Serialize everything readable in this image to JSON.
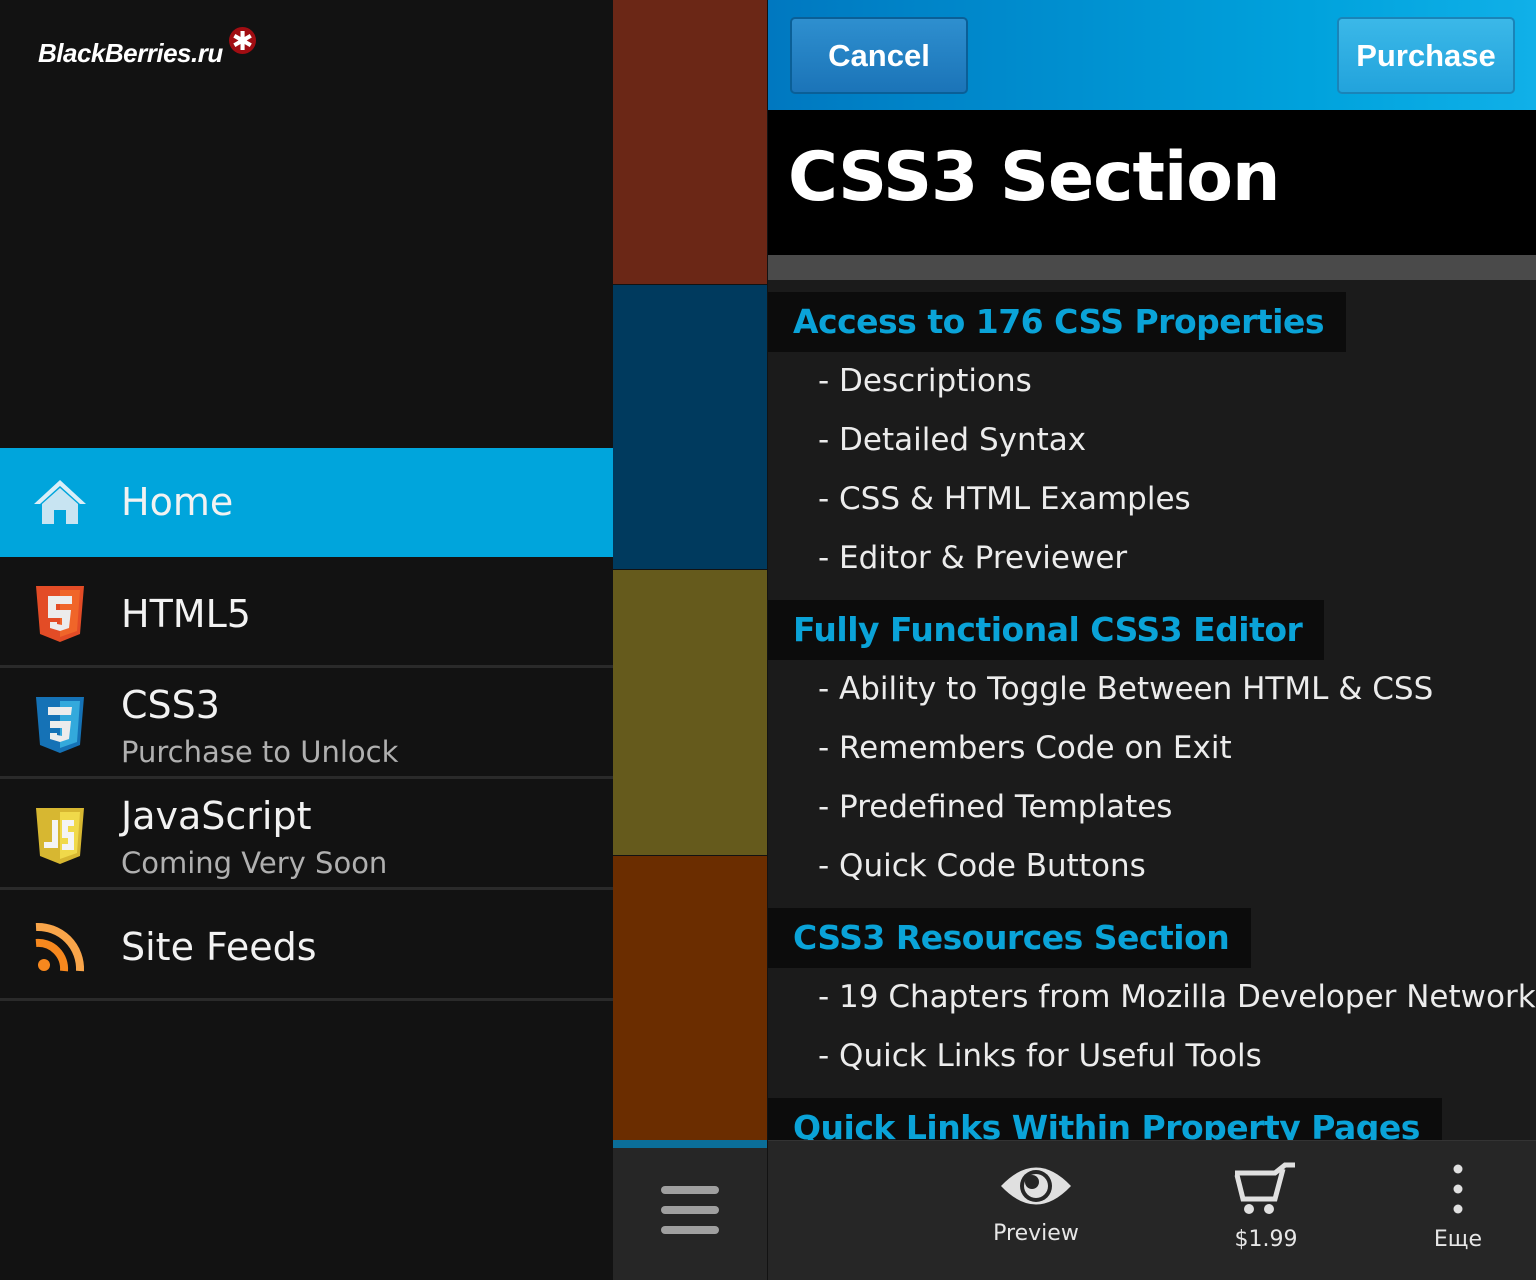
{
  "logo": {
    "text": "BlackBerries.ru",
    "star": "*"
  },
  "sidebar": {
    "items": [
      {
        "label": "Home",
        "icon": "home-icon",
        "active": true
      },
      {
        "label": "HTML5",
        "icon": "html5-icon"
      },
      {
        "label": "CSS3",
        "sub": "Purchase to Unlock",
        "icon": "css3-icon"
      },
      {
        "label": "JavaScript",
        "sub": "Coming Very Soon",
        "icon": "javascript-icon"
      },
      {
        "label": "Site Feeds",
        "icon": "rss-icon"
      }
    ]
  },
  "colors": {
    "accent": "#00a5dc",
    "heading": "#0aa3d8",
    "tile1": "#6b2716",
    "tile2": "#003a5e",
    "tile3": "#655a1c",
    "tile4": "#6b2d00"
  },
  "header": {
    "cancel": "Cancel",
    "purchase": "Purchase"
  },
  "main": {
    "title": "CSS3 Section",
    "sections": [
      {
        "heading": "Access to 176 CSS Properties",
        "items": [
          "- Descriptions",
          "- Detailed Syntax",
          "- CSS & HTML Examples",
          "- Editor & Previewer"
        ]
      },
      {
        "heading": "Fully Functional CSS3 Editor",
        "items": [
          "- Ability to Toggle Between HTML & CSS",
          "- Remembers Code on Exit",
          "- Predefined Templates",
          "- Quick Code Buttons"
        ]
      },
      {
        "heading": "CSS3 Resources Section",
        "items": [
          "- 19 Chapters from Mozilla Developer Network",
          "- Quick Links for Useful Tools"
        ]
      },
      {
        "heading": "Quick Links Within Property Pages",
        "items": []
      }
    ]
  },
  "actionbar": {
    "preview": "Preview",
    "price": "$1.99",
    "more": "Еще"
  }
}
